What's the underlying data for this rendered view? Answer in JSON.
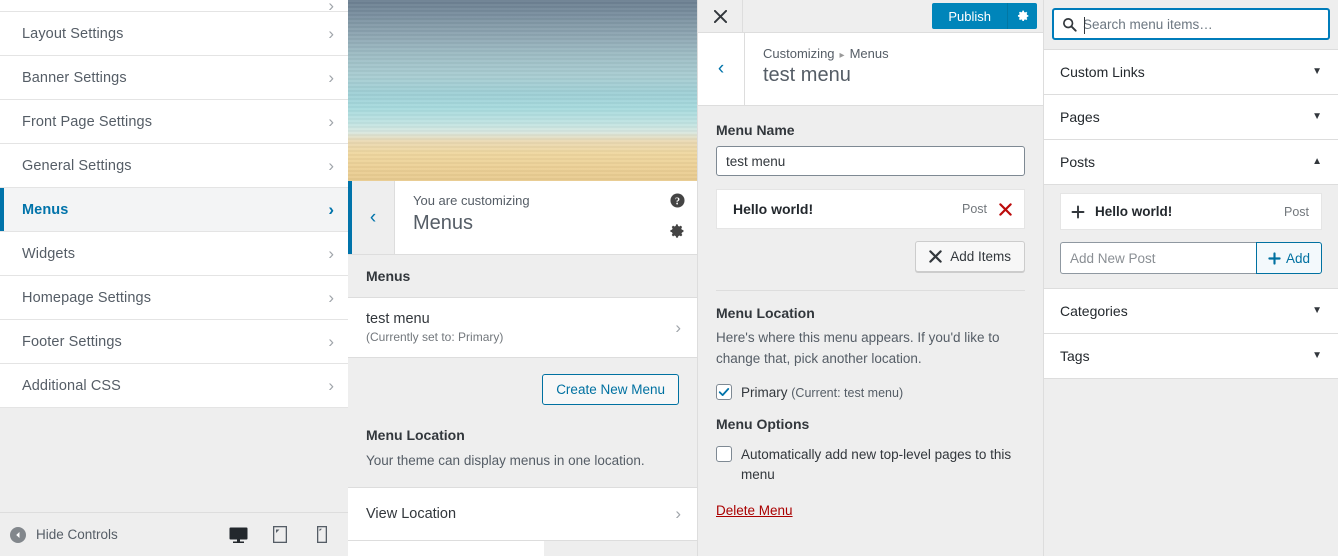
{
  "panel1": {
    "items": [
      {
        "label": "",
        "partial": true,
        "active": false
      },
      {
        "label": "Layout Settings",
        "active": false
      },
      {
        "label": "Banner Settings",
        "active": false
      },
      {
        "label": "Front Page Settings",
        "active": false
      },
      {
        "label": "General Settings",
        "active": false
      },
      {
        "label": "Menus",
        "active": true
      },
      {
        "label": "Widgets",
        "active": false
      },
      {
        "label": "Homepage Settings",
        "active": false
      },
      {
        "label": "Footer Settings",
        "active": false
      },
      {
        "label": "Additional CSS",
        "active": false
      }
    ],
    "bottom_bar": {
      "hide_controls_label": "Hide Controls",
      "devices": [
        "desktop",
        "tablet",
        "mobile"
      ],
      "active_device": "desktop"
    }
  },
  "panel2": {
    "back_label": "‹",
    "you_are_customizing": "You are customizing",
    "title": "Menus",
    "section_title": "Menus",
    "menu_row": {
      "name": "test menu",
      "sub": "(Currently set to: Primary)"
    },
    "create_new_menu": "Create New Menu",
    "menu_location_title": "Menu Location",
    "menu_location_desc": "Your theme can display menus in one location.",
    "view_location": "View Location"
  },
  "panel3": {
    "topbar": {
      "close_icon": "close-icon",
      "publish_label": "Publish",
      "gear_icon": "gear-icon"
    },
    "breadcrumb_root": "Customizing",
    "breadcrumb_sep": "▸",
    "breadcrumb_current": "Menus",
    "title": "test menu",
    "menu_name_label": "Menu Name",
    "menu_name_value": "test menu",
    "menu_items": [
      {
        "title": "Hello world!",
        "type": "Post"
      }
    ],
    "add_items_label": "Add Items",
    "menu_location_title": "Menu Location",
    "menu_location_desc": "Here's where this menu appears. If you'd like to change that, pick another location.",
    "location_checkbox": {
      "label": "Primary",
      "note": "(Current: test menu)",
      "checked": true
    },
    "menu_options_title": "Menu Options",
    "auto_add_checkbox": {
      "label": "Automatically add new top-level pages to this menu",
      "checked": false
    },
    "delete_menu": "Delete Menu"
  },
  "panel4": {
    "search_placeholder": "Search menu items…",
    "search_value": "",
    "sections": [
      {
        "label": "Custom Links",
        "expanded": false
      },
      {
        "label": "Pages",
        "expanded": false
      },
      {
        "label": "Posts",
        "expanded": true
      },
      {
        "label": "Categories",
        "expanded": false
      },
      {
        "label": "Tags",
        "expanded": false
      }
    ],
    "posts": [
      {
        "title": "Hello world!",
        "type": "Post"
      }
    ],
    "add_new_post_placeholder": "Add New Post",
    "add_new_post_value": "",
    "add_button_label": "Add"
  },
  "colors": {
    "wp_blue": "#0085ba",
    "link_blue": "#0073aa",
    "accent_border": "#007cba",
    "delete_red": "#a00",
    "item_delete_red": "#bc0b0b",
    "panel_bg": "#eeeeee",
    "text_dark": "#32373c",
    "text_muted": "#555d66"
  }
}
